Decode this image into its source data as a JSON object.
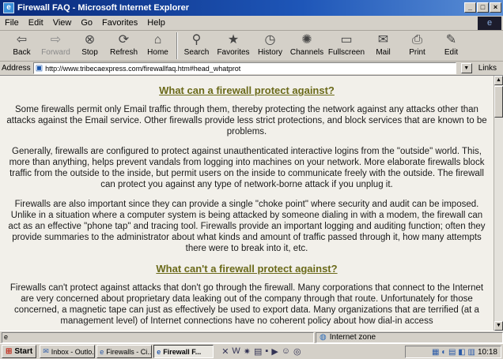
{
  "window": {
    "title": "Firewall FAQ - Microsoft Internet Explorer"
  },
  "menu": [
    "File",
    "Edit",
    "View",
    "Go",
    "Favorites",
    "Help"
  ],
  "toolbar": [
    {
      "label": "Back",
      "icon": "back-arrow-icon",
      "glyph": "⇦"
    },
    {
      "label": "Forward",
      "icon": "forward-arrow-icon",
      "glyph": "⇨"
    },
    {
      "label": "Stop",
      "icon": "stop-icon",
      "glyph": "⊗"
    },
    {
      "label": "Refresh",
      "icon": "refresh-icon",
      "glyph": "⟳"
    },
    {
      "label": "Home",
      "icon": "home-icon",
      "glyph": "⌂"
    },
    {
      "label": "Search",
      "icon": "search-icon",
      "glyph": "⚲"
    },
    {
      "label": "Favorites",
      "icon": "favorites-icon",
      "glyph": "★"
    },
    {
      "label": "History",
      "icon": "history-icon",
      "glyph": "◷"
    },
    {
      "label": "Channels",
      "icon": "channels-icon",
      "glyph": "✺"
    },
    {
      "label": "Fullscreen",
      "icon": "fullscreen-icon",
      "glyph": "▭"
    },
    {
      "label": "Mail",
      "icon": "mail-icon",
      "glyph": "✉"
    },
    {
      "label": "Print",
      "icon": "print-icon",
      "glyph": "⎙"
    },
    {
      "label": "Edit",
      "icon": "edit-icon",
      "glyph": "✎"
    }
  ],
  "address": {
    "label": "Address",
    "url": "http://www.tribecaexpress.com/firewallfaq.htm#head_whatprot",
    "links_label": "Links"
  },
  "content": {
    "heading1": "What can a firewall protect against?",
    "p1": "Some firewalls permit only Email traffic through them, thereby protecting the network against any attacks other than attacks against the Email service. Other firewalls provide less strict protections, and block services that are known to be problems.",
    "p2": "Generally, firewalls are configured to protect against unauthenticated interactive logins from the \"outside\" world. This, more than anything, helps prevent vandals from logging into machines on your network. More elaborate firewalls block traffic from the outside to the inside, but permit users on the inside to communicate freely with the outside. The firewall can protect you against any type of network-borne attack if you unplug it.",
    "p3": "Firewalls are also important since they can provide a single \"choke point\" where security and audit can be imposed. Unlike in a situation where a computer system is being attacked by someone dialing in with a modem, the firewall can act as an effective \"phone tap\" and tracing tool. Firewalls provide an important logging and auditing function; often they provide summaries to the administrator about what kinds and amount of traffic passed through it, how many attempts there were to break into it, etc.",
    "heading2": "What can't a firewall protect against?",
    "p4": "Firewalls can't protect against attacks that don't go through the firewall. Many corporations that connect to the Internet are very concerned about proprietary data leaking out of the company through that route. Unfortunately for those concerned, a magnetic tape can just as effectively be used to export data. Many organizations that are terrified (at a management level) of Internet connections have no coherent policy about how dial-in access"
  },
  "status": {
    "zone": "Internet zone"
  },
  "taskbar": {
    "start": "Start",
    "tasks": [
      "Inbox - Outlo...",
      "Firewalls - Ci...",
      "Firewall F..."
    ],
    "clock": "10:18"
  }
}
